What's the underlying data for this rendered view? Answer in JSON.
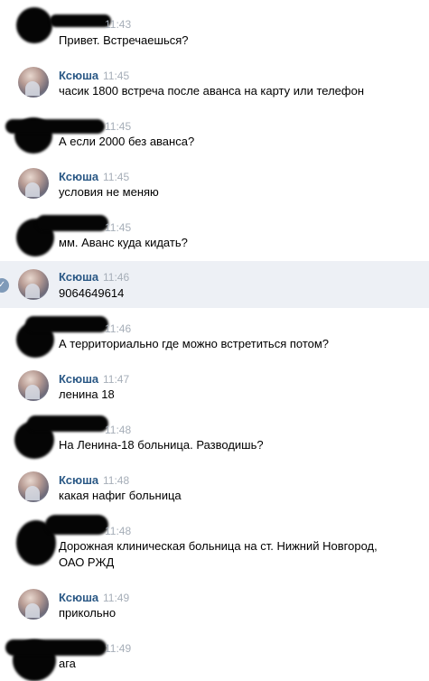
{
  "messages": [
    {
      "sender": "",
      "time": "11:43",
      "text": "Привет. Встречаешься?"
    },
    {
      "sender": "Ксюша",
      "time": "11:45",
      "text": "часик 1800 встреча после аванса на карту или телефон"
    },
    {
      "sender": "",
      "time": "11:45",
      "text": "А если 2000 без аванса?"
    },
    {
      "sender": "Ксюша",
      "time": "11:45",
      "text": "условия не меняю"
    },
    {
      "sender": "",
      "time": "11:45",
      "text": "мм. Аванс куда кидать?"
    },
    {
      "sender": "Ксюша",
      "time": "11:46",
      "text": "9064649614"
    },
    {
      "sender": "",
      "time": "11:46",
      "text": "А территориально где можно встретиться потом?"
    },
    {
      "sender": "Ксюша",
      "time": "11:47",
      "text": "ленина 18"
    },
    {
      "sender": "",
      "time": "11:48",
      "text": "На Ленина-18 больница. Разводишь?"
    },
    {
      "sender": "Ксюша",
      "time": "11:48",
      "text": "какая нафиг больница"
    },
    {
      "sender": "",
      "time": "11:48",
      "text": "Дорожная клиническая больница на ст. Нижний Новгород, ОАО РЖД"
    },
    {
      "sender": "Ксюша",
      "time": "11:49",
      "text": "прикольно"
    },
    {
      "sender": "",
      "time": "11:49",
      "text": "ага"
    }
  ],
  "colors": {
    "sender_name": "#2a5885",
    "time": "#a6aeb8",
    "selected_bg": "#edf0f5"
  },
  "icons": {
    "selected_check": "check-icon"
  }
}
